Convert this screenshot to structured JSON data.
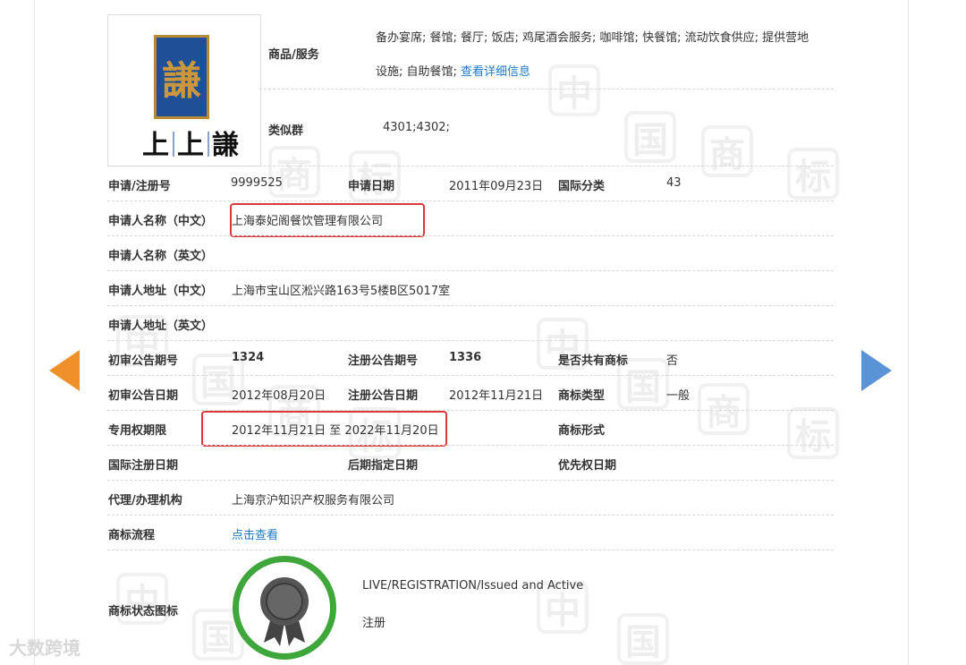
{
  "logo": {
    "brand_text": "上上謙",
    "seal_char": "謙"
  },
  "goods": {
    "label": "商品/服务",
    "line1": "备办宴席; 餐馆; 餐厅; 饭店; 鸡尾酒会服务; 咖啡馆; 快餐馆; 流动饮食供应; 提供营地",
    "line2": "设施; 自助餐馆;",
    "detail_link": "查看详细信息"
  },
  "similar_group": {
    "label": "类似群",
    "value": "4301;4302;"
  },
  "fields": {
    "reg_no_label": "申请/注册号",
    "reg_no": "9999525",
    "app_date_label": "申请日期",
    "app_date": "2011年09月23日",
    "intl_class_label": "国际分类",
    "intl_class": "43",
    "applicant_cn_label": "申请人名称（中文）",
    "applicant_cn": "上海泰妃阁餐饮管理有限公司",
    "applicant_en_label": "申请人名称（英文）",
    "address_cn_label": "申请人地址（中文）",
    "address_cn": "上海市宝山区淞兴路163号5楼B区5017室",
    "address_en_label": "申请人地址（英文）",
    "prelim_no_label": "初审公告期号",
    "prelim_no": "1324",
    "reg_pub_no_label": "注册公告期号",
    "reg_pub_no": "1336",
    "shared_label": "是否共有商标",
    "shared": "否",
    "prelim_date_label": "初审公告日期",
    "prelim_date": "2012年08月20日",
    "reg_pub_date_label": "注册公告日期",
    "reg_pub_date": "2012年11月21日",
    "tm_type_label": "商标类型",
    "tm_type": "一般",
    "exclusive_label": "专用权期限",
    "exclusive": "2012年11月21日 至 2022年11月20日",
    "tm_form_label": "商标形式",
    "intl_reg_date_label": "国际注册日期",
    "later_date_label": "后期指定日期",
    "priority_date_label": "优先权日期",
    "agent_label": "代理/办理机构",
    "agent": "上海京沪知识产权服务有限公司",
    "process_label": "商标流程",
    "process_link": "点击查看",
    "status_label": "商标状态图标",
    "status_en": "LIVE/REGISTRATION/Issued and Active",
    "status_cn": "注册"
  },
  "watermark": "大数跨境",
  "colors": {
    "link": "#1a7ac8",
    "highlight": "#d93a3a",
    "arrow_left": "#f0902a",
    "arrow_right": "#5a93d6",
    "status_ring": "#3ea63a"
  }
}
